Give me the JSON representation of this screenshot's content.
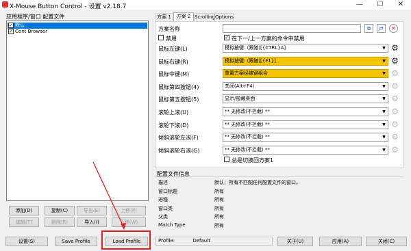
{
  "window": {
    "title": "X-Mouse Button Control - 设置 v2.18.7"
  },
  "left": {
    "list_header": "应用程序/窗口 配置文件",
    "items": [
      {
        "label": "默认",
        "checked": true,
        "selected": true
      },
      {
        "label": "Cent Browser",
        "checked": true,
        "selected": false
      }
    ],
    "buttons": {
      "add": "添加(D)",
      "copy": "复制(C)",
      "export": "导出(E)",
      "up": "上移(P)",
      "edit": "编辑(T)",
      "remove": "删除(R)",
      "import": "导入(I)",
      "down": "下移(W)"
    }
  },
  "tabs": [
    "方案 1",
    "方案 2",
    "Scrolling",
    "Options"
  ],
  "active_tab": "方案 2",
  "scheme": {
    "name_label": "方案名称",
    "name_value": "",
    "disable_label": "禁用",
    "disable_checked": false,
    "disable_in_cmd_label": "在下一/上一方案的命令中禁用",
    "disable_in_cmd_checked": true,
    "rows": [
      {
        "label": "鼠标左键(L)",
        "value": "模拟按键: (跟随)[{CTRL}A]",
        "highlight": false,
        "gear_enabled": true
      },
      {
        "label": "鼠标右键(R)",
        "value": "模拟按键: (跟随)[{F1}]",
        "highlight": true,
        "gear_enabled": true
      },
      {
        "label": "鼠标中键(M)",
        "value": "重置方案经被键组合",
        "highlight": true,
        "gear_enabled": false
      },
      {
        "label": "鼠标第四按钮(4)",
        "value": "关闭(Alt+F4)",
        "highlight": false,
        "gear_enabled": false
      },
      {
        "label": "鼠标第五按钮(5)",
        "value": "显示/隐藏桌面",
        "highlight": false,
        "gear_enabled": false
      },
      {
        "label": "滚轮上滚(U)",
        "value": "** 无修改(不拦截) **",
        "highlight": false,
        "gear_enabled": false
      },
      {
        "label": "滚轮下滚(D)",
        "value": "** 无修改(不拦截) **",
        "highlight": false,
        "gear_enabled": false
      },
      {
        "label": "倾斜滚轮左滚(F)",
        "value": "** 无修改(不拦截) **",
        "highlight": false,
        "gear_enabled": false
      },
      {
        "label": "倾斜滚轮右滚(G)",
        "value": "** 无修改(不拦截) **",
        "highlight": false,
        "gear_enabled": false
      }
    ],
    "always_switch_label": "总是切换回方案1",
    "always_switch_checked": false
  },
  "profile_info": {
    "header": "配置文件信息",
    "rows": [
      {
        "key": "描述",
        "value": "默认：所有不匹配任何配置文件的窗口。"
      },
      {
        "key": "窗口标题",
        "value": "所有"
      },
      {
        "key": "进程",
        "value": "所有"
      },
      {
        "key": "窗口类",
        "value": "所有"
      },
      {
        "key": "父类",
        "value": "所有"
      },
      {
        "key": "Match Type",
        "value": "所有"
      }
    ]
  },
  "bottom": {
    "settings": "设置(S)",
    "save_profile": "Save Profile",
    "load_profile": "Load Profile",
    "profile_label": "Profile:",
    "profile_value": "Default",
    "about": "关于(U)",
    "apply": "应用(A)",
    "close": "关闭(C)"
  },
  "colors": {
    "highlight": "#f5c400",
    "selection": "#0078d7",
    "annotation": "#e02020"
  },
  "icons": [
    "app-icon",
    "minimize-icon",
    "maximize-icon",
    "close-icon",
    "gear-icon",
    "copy-icon",
    "swap-icon",
    "delete-icon",
    "dropdown-arrow-icon",
    "checkbox-icon"
  ]
}
